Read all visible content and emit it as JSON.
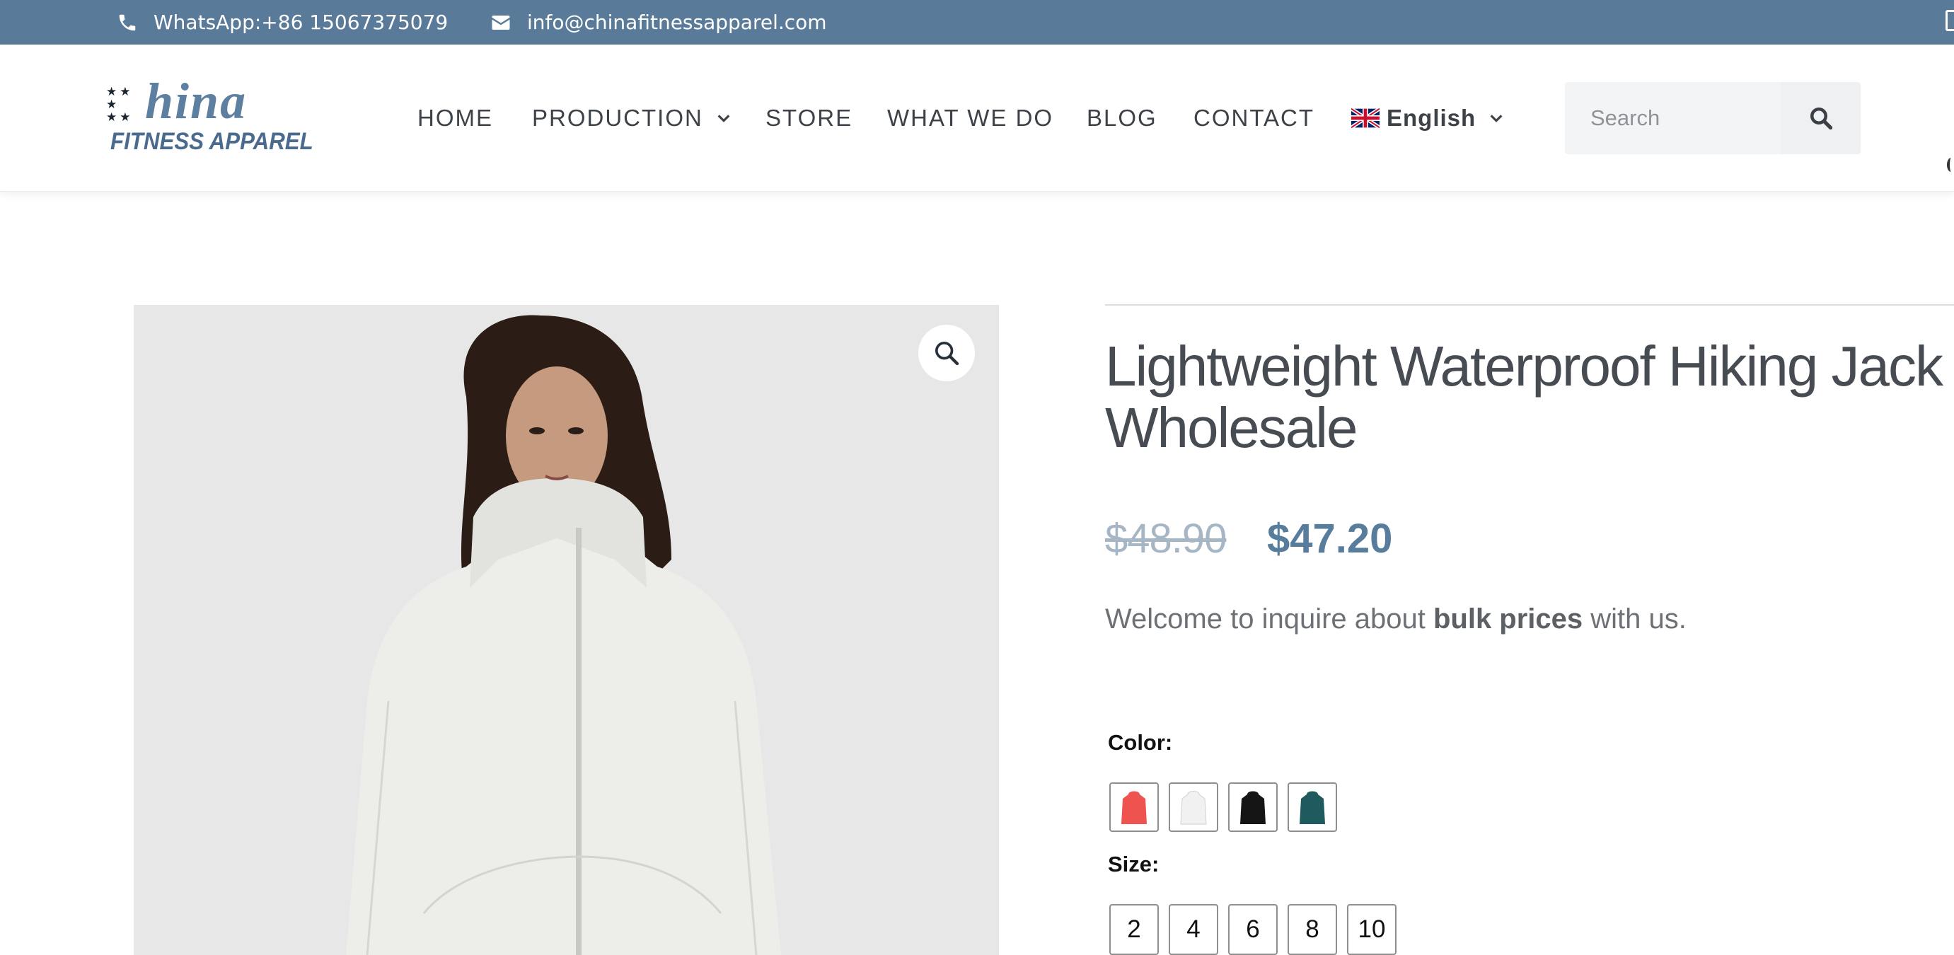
{
  "topbar": {
    "whatsapp": "WhatsApp:+86 15067375079",
    "email": "info@chinafitnessapparel.com"
  },
  "logo": {
    "word": "hina",
    "subtitle": "FITNESS APPAREL"
  },
  "nav": {
    "items": [
      {
        "label": "HOME",
        "has_dropdown": false
      },
      {
        "label": "PRODUCTION",
        "has_dropdown": true
      },
      {
        "label": "STORE",
        "has_dropdown": false
      },
      {
        "label": "WHAT WE DO",
        "has_dropdown": false
      },
      {
        "label": "BLOG",
        "has_dropdown": false
      },
      {
        "label": "CONTACT",
        "has_dropdown": false
      }
    ],
    "language": "English"
  },
  "search": {
    "placeholder": "Search"
  },
  "product": {
    "title_line1": "Lightweight Waterproof Hiking Jack",
    "title_line2": "Wholesale",
    "price_old": "$48.90",
    "price_new": "$47.20",
    "inquire_prefix": "Welcome to inquire about ",
    "inquire_bold": "bulk prices",
    "inquire_suffix": " with us.",
    "color_label": "Color:",
    "colors": [
      "#ef5350",
      "#f1f1f1",
      "#151515",
      "#1e5a5e"
    ],
    "size_label": "Size:",
    "sizes": [
      "2",
      "4",
      "6",
      "8",
      "10"
    ]
  },
  "colors": {
    "topbar": "#597b99",
    "accent": "#587c9c",
    "image_bg": "#e7e7e7"
  }
}
